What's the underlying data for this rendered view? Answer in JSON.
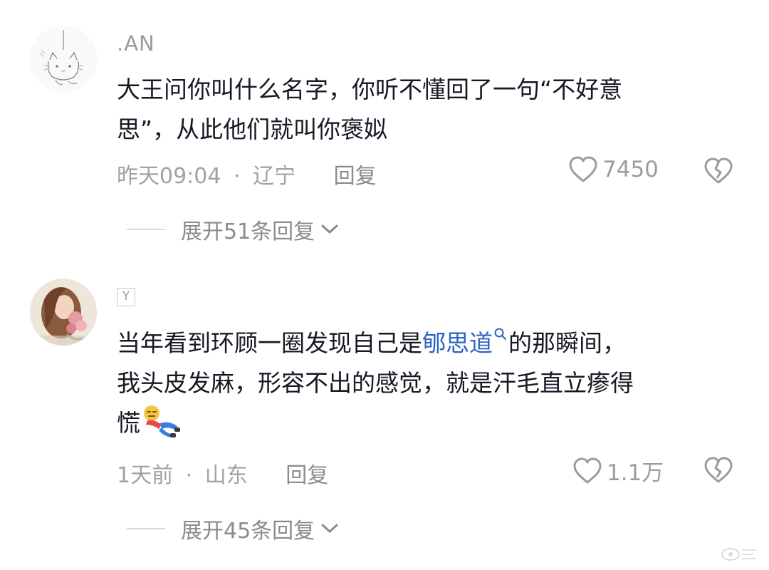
{
  "comments": [
    {
      "username": ".AN",
      "text_lines": [
        "大王问你叫什么名字，你听不懂回了一句“不好意",
        "思”，从此他们就叫你褒姒"
      ],
      "time": "昨天09:04",
      "separator": "·",
      "location": "辽宁",
      "reply_label": "回复",
      "likes": "7450",
      "expand_label": "展开51条回复"
    },
    {
      "badge": "Y",
      "text_before_link": "当年看到环顾一圈发现自己是",
      "link_text": "郇思道",
      "text_after_link": "的那瞬间，",
      "text_line2": "我头皮发麻，形容不出的感觉，就是汗毛直立瘆得",
      "text_line3": "慌",
      "time": "1天前",
      "separator": "·",
      "location": "山东",
      "reply_label": "回复",
      "likes": "1.1万",
      "expand_label": "展开45条回复"
    }
  ],
  "icons": {
    "like": "heart-outline-icon",
    "dislike": "broken-heart-icon",
    "expand": "chevron-down-icon",
    "search": "search-icon"
  },
  "colors": {
    "text": "#161823",
    "secondary": "#a1a2a6",
    "link": "#2f64c4"
  }
}
